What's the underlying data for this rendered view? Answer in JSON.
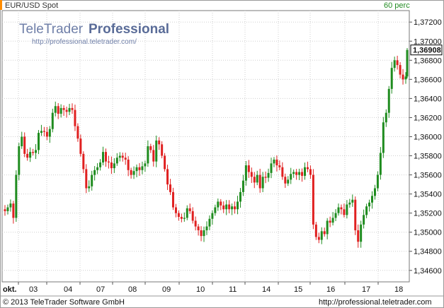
{
  "header": {
    "instrument": "EUR/USD Spot",
    "period": "60 perc"
  },
  "watermark": {
    "brand_plain": "TeleTrader",
    "brand_bold": "Professional",
    "url": "http://professional.teletrader.com/"
  },
  "footer": {
    "copyright": "© 2013 TeleTrader Software GmbH",
    "url": "http://professional.teletrader.com"
  },
  "colors": {
    "up": "#1f8c1f",
    "down": "#e02020",
    "grid": "#cfcfcf",
    "header_bg": "#ffffff",
    "header_accent": "#ff8c00",
    "period_text": "#228b22",
    "last_price_box": "#000000"
  },
  "chart_data": {
    "type": "candlestick",
    "title": "EUR/USD Spot",
    "timeframe": "60 perc",
    "x_tick_labels": [
      "okt.",
      "03",
      "04",
      "07",
      "08",
      "09",
      "10",
      "11",
      "14",
      "15",
      "16",
      "17",
      "18"
    ],
    "y_tick_labels": [
      "1,37200",
      "1,37000",
      "1,36908",
      "1,36800",
      "1,36600",
      "1,36400",
      "1,36200",
      "1,36000",
      "1,35800",
      "1,35600",
      "1,35400",
      "1,35200",
      "1,35000",
      "1,34800",
      "1,34600"
    ],
    "y_ticks": [
      1.372,
      1.37,
      1.368,
      1.366,
      1.364,
      1.362,
      1.36,
      1.358,
      1.356,
      1.354,
      1.352,
      1.35,
      1.348,
      1.346
    ],
    "ylim": [
      1.3448,
      1.3732
    ],
    "last_price": 1.36908,
    "last_price_label": "1,36908",
    "grid": true,
    "closes": [
      1.3522,
      1.3526,
      1.353,
      1.3515,
      1.356,
      1.359,
      1.36,
      1.3582,
      1.3578,
      1.3584,
      1.3583,
      1.3586,
      1.3604,
      1.3606,
      1.3605,
      1.36,
      1.3608,
      1.3625,
      1.3632,
      1.3624,
      1.363,
      1.3628,
      1.3626,
      1.363,
      1.3628,
      1.3611,
      1.3598,
      1.3582,
      1.3566,
      1.3546,
      1.3548,
      1.356,
      1.3565,
      1.3568,
      1.3573,
      1.3584,
      1.3574,
      1.3573,
      1.3567,
      1.3572,
      1.3578,
      1.358,
      1.3578,
      1.3576,
      1.3565,
      1.356,
      1.3564,
      1.3568,
      1.3565,
      1.3569,
      1.3572,
      1.359,
      1.3586,
      1.3574,
      1.3596,
      1.3592,
      1.358,
      1.3566,
      1.355,
      1.3542,
      1.3526,
      1.352,
      1.3516,
      1.3514,
      1.3515,
      1.3525,
      1.3522,
      1.3512,
      1.3506,
      1.3502,
      1.3496,
      1.3502,
      1.3506,
      1.3514,
      1.352,
      1.3526,
      1.3532,
      1.3528,
      1.3524,
      1.3529,
      1.3524,
      1.3527,
      1.3524,
      1.3532,
      1.3542,
      1.3554,
      1.357,
      1.3563,
      1.3558,
      1.3552,
      1.356,
      1.3546,
      1.3558,
      1.3557,
      1.3562,
      1.3572,
      1.3576,
      1.357,
      1.3568,
      1.3558,
      1.3551,
      1.3555,
      1.3561,
      1.3563,
      1.356,
      1.3563,
      1.3559,
      1.3568,
      1.3566,
      1.356,
      1.3508,
      1.3495,
      1.3492,
      1.3501,
      1.3498,
      1.3512,
      1.351,
      1.3515,
      1.352,
      1.3526,
      1.3524,
      1.3518,
      1.3529,
      1.3531,
      1.3534,
      1.3502,
      1.349,
      1.3508,
      1.3518,
      1.3527,
      1.3531,
      1.3538,
      1.3546,
      1.356,
      1.3583,
      1.3615,
      1.3625,
      1.365,
      1.3672,
      1.368,
      1.3675,
      1.3665,
      1.366,
      1.3663
    ],
    "open": 1.3524,
    "final_close": 1.36908,
    "x_start_label": "okt."
  }
}
